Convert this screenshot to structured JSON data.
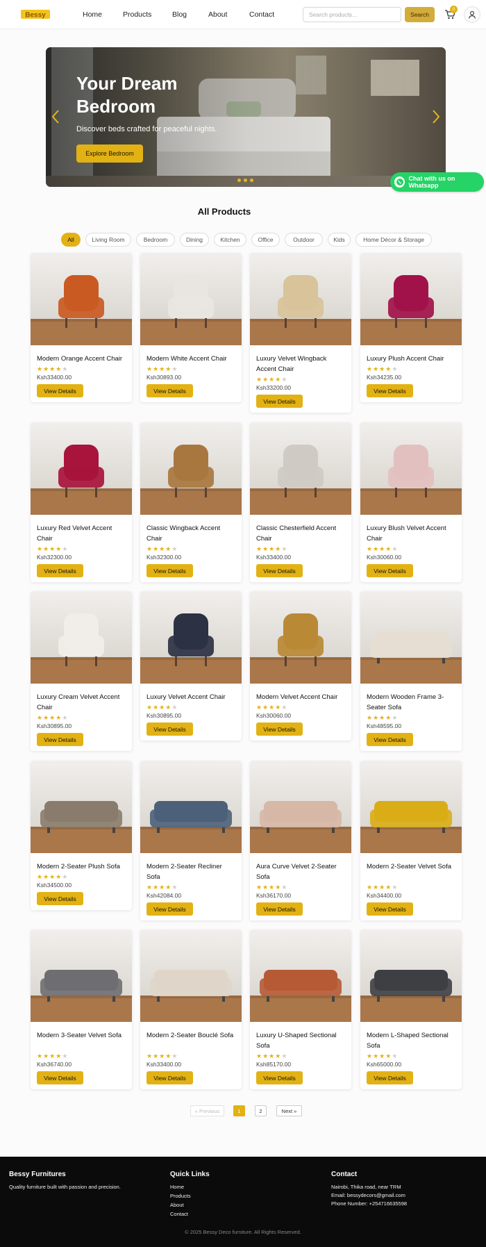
{
  "brand": {
    "logo_text": "Bessy"
  },
  "nav": {
    "home": "Home",
    "products": "Products",
    "blog": "Blog",
    "about": "About",
    "contact": "Contact"
  },
  "search": {
    "placeholder": "Search products...",
    "button": "Search"
  },
  "cart": {
    "count": "0",
    "icon": "cart-icon"
  },
  "hero": {
    "title": "Your Dream Bedroom",
    "subtitle": "Discover beds crafted for peaceful nights.",
    "cta": "Explore Bedroom"
  },
  "whatsapp": {
    "label": "Chat with us on Whatsapp"
  },
  "products_section": {
    "title": "All Products"
  },
  "categories": [
    "All",
    "Living Room",
    "Bedroom",
    "Dining",
    "Kitchen",
    "Office",
    "Outdoor",
    "Kids",
    "Home Décor & Storage"
  ],
  "active_category": "All",
  "view_details_label": "View Details",
  "products": [
    {
      "name": "Modern Orange Accent Chair",
      "rating": 4,
      "price": "Ksh33400.00",
      "color": "#c95a22"
    },
    {
      "name": "Modern White Accent Chair",
      "rating": 4,
      "price": "Ksh30893.00",
      "color": "#e9e6e1"
    },
    {
      "name": "Luxury Velvet Wingback Accent Chair",
      "rating": 4,
      "price": "Ksh33200.00",
      "color": "#d8c39a"
    },
    {
      "name": "Luxury Plush Accent Chair",
      "rating": 4,
      "price": "Ksh34235.00",
      "color": "#a1124a"
    },
    {
      "name": "Luxury Red Velvet Accent Chair",
      "rating": 4,
      "price": "Ksh32300.00",
      "color": "#a8143c"
    },
    {
      "name": "Classic Wingback Accent Chair",
      "rating": 4,
      "price": "Ksh32300.00",
      "color": "#a8773f"
    },
    {
      "name": "Classic Chesterfield Accent Chair",
      "rating": 4,
      "price": "Ksh33400.00",
      "color": "#cfcac3"
    },
    {
      "name": "Luxury Blush Velvet Accent Chair",
      "rating": 4,
      "price": "Ksh30060.00",
      "color": "#e3c0c0"
    },
    {
      "name": "Luxury Cream Velvet Accent Chair",
      "rating": 4,
      "price": "Ksh30895.00",
      "color": "#f1eee9"
    },
    {
      "name": "Luxury Velvet Accent Chair",
      "rating": 4,
      "price": "Ksh30895.00",
      "color": "#2c3143"
    },
    {
      "name": "Modern Velvet Accent Chair",
      "rating": 4,
      "price": "Ksh30060.00",
      "color": "#b98935"
    },
    {
      "name": "Modern Wooden Frame 3-Seater Sofa",
      "rating": 4,
      "price": "Ksh48595.00",
      "color": "#e6ded2"
    },
    {
      "name": "Modern 2-Seater Plush Sofa",
      "rating": 4,
      "price": "Ksh34500.00",
      "color": "#8a7c6d"
    },
    {
      "name": "Modern 2-Seater Recliner Sofa",
      "rating": 4,
      "price": "Ksh42084.00",
      "color": "#4d6079"
    },
    {
      "name": "Aura Curve Velvet 2-Seater Sofa",
      "rating": 4,
      "price": "Ksh36170.00",
      "color": "#d7b7a6"
    },
    {
      "name": "Modern 2-Seater Velvet Sofa",
      "rating": 4,
      "price": "Ksh34400.00",
      "color": "#d9ad17"
    },
    {
      "name": "Modern 3-Seater Velvet Sofa",
      "rating": 4,
      "price": "Ksh36740.00",
      "color": "#6e6e72"
    },
    {
      "name": "Modern 2-Seater Bouclé Sofa",
      "rating": 4,
      "price": "Ksh33400.00",
      "color": "#dfd6c9"
    },
    {
      "name": "Luxury U-Shaped Sectional Sofa",
      "rating": 4,
      "price": "Ksh85170.00",
      "color": "#b65a35"
    },
    {
      "name": "Modern L-Shaped Sectional Sofa",
      "rating": 4,
      "price": "Ksh65000.00",
      "color": "#3e3f44"
    }
  ],
  "pagination": {
    "previous": "« Previous",
    "pages": [
      "1",
      "2"
    ],
    "current": "1",
    "next": "Next »"
  },
  "footer": {
    "brand_title": "Bessy Furnitures",
    "brand_tagline": "Quality furniture built with passion and precision.",
    "quick_links_title": "Quick Links",
    "quick_links": [
      "Home",
      "Products",
      "About",
      "Contact"
    ],
    "contact_title": "Contact",
    "contact_lines": [
      "Nairobi, Thika road, near TRM",
      "Email: bessydecors@gmail.com",
      "Phone Number: +254716635598"
    ],
    "copyright": "© 2025 Bessy Deco furniture. All Rights Reserved."
  },
  "colors": {
    "accent": "#e2b215",
    "whatsapp": "#25d366",
    "footer_bg": "#0b0b0b"
  }
}
